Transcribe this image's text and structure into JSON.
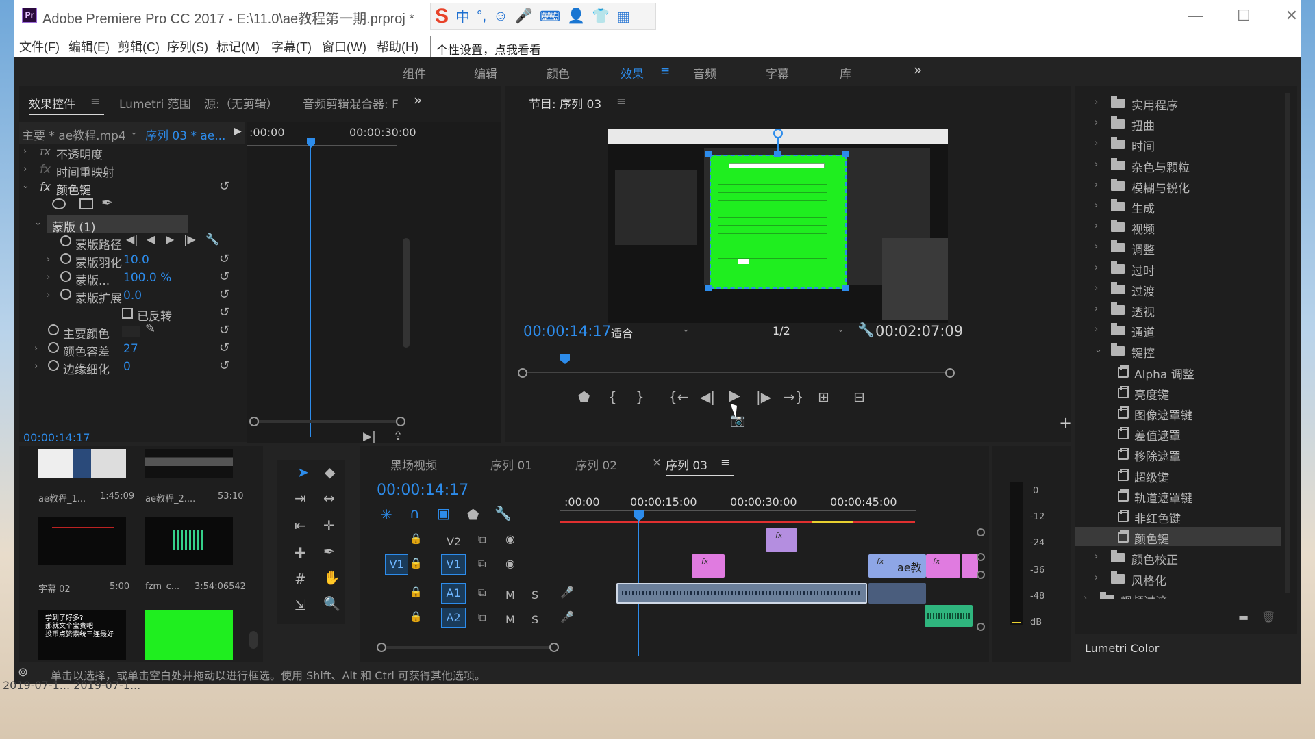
{
  "window": {
    "title": "Adobe Premiere Pro CC 2017 - E:\\11.0\\ae教程第一期.prproj *",
    "app_icon": "Pr",
    "controls": [
      "—",
      "☐",
      "✕"
    ]
  },
  "ime": {
    "items": [
      "S",
      "中",
      "°,",
      "☺",
      "🎤",
      "⌨",
      "👤",
      "👕",
      "▦"
    ]
  },
  "menu": {
    "items": [
      "文件(F)",
      "编辑(E)",
      "剪辑(C)",
      "序列(S)",
      "标记(M)",
      "字幕(T)",
      "窗口(W)",
      "帮助(H)"
    ],
    "tooltip": "个性设置，点我看看"
  },
  "workspaces": {
    "items": [
      "组件",
      "编辑",
      "颜色",
      "效果",
      "音频",
      "字幕",
      "库"
    ],
    "active": "效果",
    "menu_icon": "≡",
    "more": "»"
  },
  "effect_controls": {
    "tabs": [
      "效果控件",
      "Lumetri 范围",
      "源:（无剪辑）",
      "音频剪辑混合器: F"
    ],
    "tab_menu": "≡",
    "more": "»",
    "master_clip": "主要 * ae教程.mp4",
    "sequence_clip": "序列 03 * ae...",
    "ruler": {
      "start": ":00:00",
      "end": "00:00:30:00"
    },
    "rows": {
      "opacity": "不透明度",
      "time_remap": "时间重映射",
      "color_key": "颜色键",
      "mask": "蒙版 (1)",
      "mask_path": "蒙版路径",
      "mask_feather": {
        "label": "蒙版羽化",
        "value": "10.0"
      },
      "mask_opacity": {
        "label": "蒙版...",
        "value": "100.0 %"
      },
      "mask_expand": {
        "label": "蒙版扩展",
        "value": "0.0"
      },
      "inverted": "已反转",
      "key_color": "主要颜色",
      "color_tolerance": {
        "label": "颜色容差",
        "value": "27"
      },
      "edge_thin": {
        "label": "边缘细化",
        "value": "0"
      }
    },
    "fx": "fx",
    "timecode": "00:00:14:17"
  },
  "program": {
    "title": "节目: 序列 03",
    "menu_icon": "≡",
    "timecode": "00:00:14:17",
    "fit": "适合",
    "resolution": "1/2",
    "duration": "00:02:07:09",
    "add": "+"
  },
  "effects_panel": {
    "folders": [
      "实用程序",
      "扭曲",
      "时间",
      "杂色与颗粒",
      "模糊与锐化",
      "生成",
      "视频",
      "调整",
      "过时",
      "过渡",
      "透视",
      "通道",
      "键控"
    ],
    "keying_items": [
      "Alpha 调整",
      "亮度键",
      "图像遮罩键",
      "差值遮罩",
      "移除遮罩",
      "超级键",
      "轨道遮罩键",
      "非红色键",
      "颜色键"
    ],
    "selected": "颜色键",
    "folders_after": [
      "颜色校正",
      "风格化"
    ],
    "top_level": [
      "视频过渡"
    ],
    "bottom_tab": "Lumetri Color"
  },
  "project": {
    "items": [
      {
        "name": "ae教程_1...",
        "dur": "1:45:09"
      },
      {
        "name": "ae教程_2....",
        "dur": "53:10"
      },
      {
        "name": "字幕 02",
        "dur": "5:00"
      },
      {
        "name": "fzm_c...",
        "dur": "3:54:06542"
      },
      {
        "name": "",
        "dur": ""
      },
      {
        "name": "",
        "dur": ""
      }
    ],
    "subtitle_text": "学到了好多?\n那就文个宝贵吧\n投币点赞素统三连最好"
  },
  "timeline": {
    "tabs": [
      "黑场视频",
      "序列 01",
      "序列 02",
      "序列 03"
    ],
    "active": "序列 03",
    "close": "×",
    "menu_icon": "≡",
    "timecode": "00:00:14:17",
    "ruler": [
      ":00:00",
      "00:00:15:00",
      "00:00:30:00",
      "00:00:45:00"
    ],
    "tracks": [
      "V2",
      "V1",
      "A1",
      "A2"
    ],
    "source_patch_v": "V1",
    "source_patch_a": "",
    "m": "M",
    "s": "S",
    "clip_label": "ae教"
  },
  "meter": {
    "scale": [
      "0",
      "-12",
      "-24",
      "-36",
      "-48",
      "dB"
    ]
  },
  "status": {
    "text": "单击以选择，或单击空白处并拖动以进行框选。使用 Shift、Alt 和 Ctrl 可获得其他选项。"
  },
  "desktop": {
    "label": "2019-07-1... 2019-07-1..."
  }
}
